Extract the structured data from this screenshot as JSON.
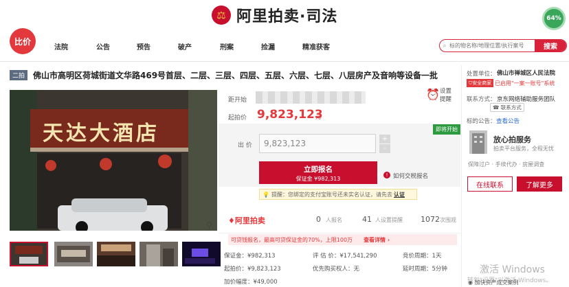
{
  "header": {
    "logo_text": "阿里拍卖·司法",
    "progress_badge": "64%"
  },
  "nav": {
    "bijia": "比价",
    "items": [
      "法院",
      "公告",
      "预告",
      "破产",
      "刑案",
      "捡漏",
      "精准获客"
    ],
    "search_placeholder": "标的物名称/地理位置/执行案号",
    "search_button": "搜索"
  },
  "item": {
    "tag": "二拍",
    "title": "佛山市高明区荷城街道文华路469号首层、二层、三层、四层、五层、六层、七层、八层房产及音响等设备一批",
    "hotel_sign": "天达大酒店"
  },
  "auction": {
    "countdown_label": "距开始",
    "start_price_label": "起拍价",
    "start_price": "9,823,123",
    "currency": "元",
    "reminder_label": "设置提醒",
    "bid_label": "出 价",
    "bid_value": "9,823,123",
    "plus": "+",
    "minus": "-",
    "status_flag": "即将开始",
    "register_button": "立即报名",
    "deposit_text": "保证金 ¥982,313",
    "howto": "如何交税报名",
    "tip_text": "提醒：您绑定的支付宝账号还未实名认证，请先去",
    "tip_link": "认证"
  },
  "stats": {
    "brand": "阿里拍卖",
    "signup_count": "0",
    "signup_label": "人报名",
    "reminder_count": "41",
    "reminder_label": "人设置提醒",
    "view_count": "1072",
    "view_label": "次围观"
  },
  "loan_bar": {
    "text": "可贷钱报名，最高可贷保证金的70%，上限100万",
    "link": "查看详情 ›"
  },
  "details": {
    "deposit": "保证金：¥982,313",
    "eval": "评 估 价：¥17,541,290",
    "cycle": "竞价周期：1天",
    "start": "起拍价：¥9,823,123",
    "priority": "优先购买权人：无",
    "delay": "延时周期：5分钟",
    "increment": "加价幅度：¥49,000"
  },
  "right": {
    "court_label": "处置单位：",
    "court": "佛山市禅城区人民法院",
    "safe_badge": "安全商家",
    "account_text": "已启用\"一案一账号\"系统",
    "contact_label": "联系方式：",
    "contact_name": "京东网络辅助服务团队",
    "contact_btn": "联系方式",
    "notice_label": "标的公告：",
    "notice_link": "查看公告",
    "service_title": "放心拍服务",
    "service_sub": "拍卖平台服务，全程无忧",
    "service_tags": "保障过户 · 手续代办 · 房屋调查",
    "online_btn": "在线联系",
    "learn_btn": "了解更多",
    "bottom_link": "加快资产成交案例"
  },
  "watermark": {
    "line1": "激活 Windows",
    "line2": "转到\"设置\"以激活 Windows。"
  }
}
